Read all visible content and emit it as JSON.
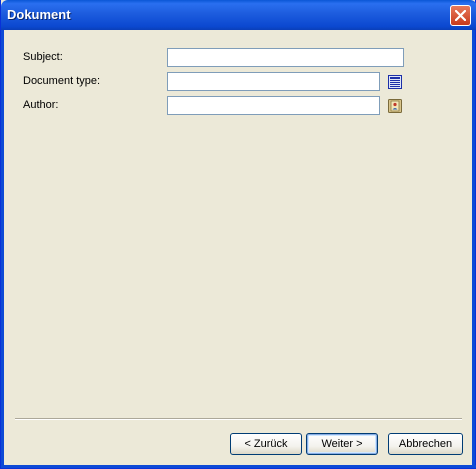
{
  "window": {
    "title": "Dokument"
  },
  "form": {
    "subject_label": "Subject:",
    "subject_value": "",
    "doctype_label": "Document type:",
    "doctype_value": "",
    "author_label": "Author:",
    "author_value": ""
  },
  "buttons": {
    "back": "< Zurück",
    "next": "Weiter >",
    "cancel": "Abbrechen"
  },
  "icons": {
    "close": "close-icon",
    "doctype_picker": "list-icon",
    "author_picker": "address-book-icon"
  }
}
